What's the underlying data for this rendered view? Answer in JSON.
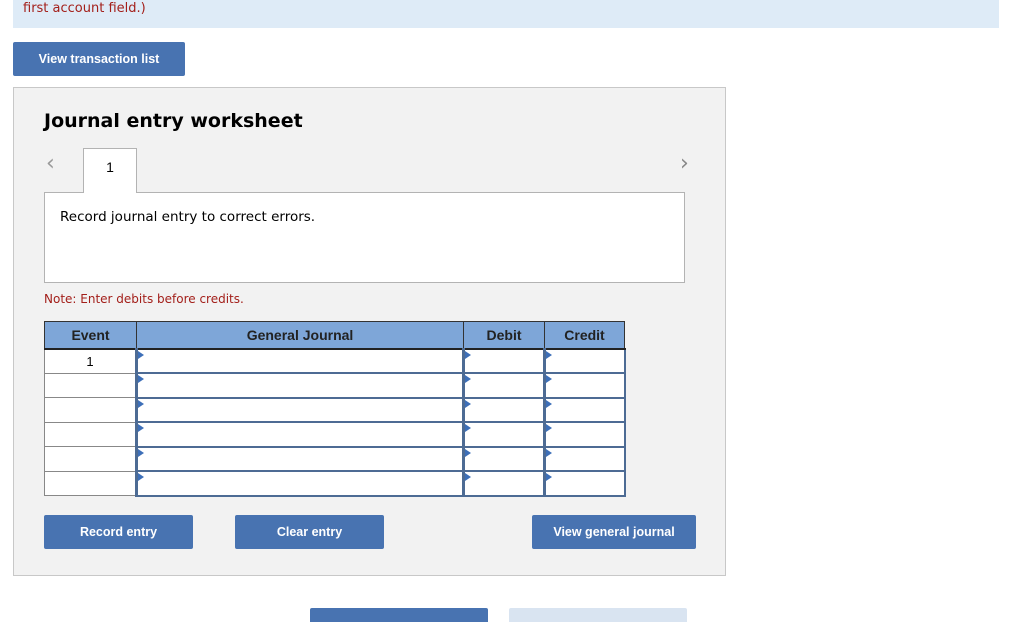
{
  "banner": {
    "text": "first account field.)"
  },
  "toolbar": {
    "view_transaction_list": "View transaction list"
  },
  "worksheet": {
    "title": "Journal entry worksheet",
    "tabs": [
      {
        "label": "1",
        "active": true
      }
    ],
    "description": "Record journal entry to correct errors.",
    "note": "Note: Enter debits before credits.",
    "table": {
      "headers": {
        "event": "Event",
        "account": "General Journal",
        "debit": "Debit",
        "credit": "Credit"
      },
      "rows": [
        {
          "event": "1",
          "account": "",
          "debit": "",
          "credit": ""
        },
        {
          "event": "",
          "account": "",
          "debit": "",
          "credit": ""
        },
        {
          "event": "",
          "account": "",
          "debit": "",
          "credit": ""
        },
        {
          "event": "",
          "account": "",
          "debit": "",
          "credit": ""
        },
        {
          "event": "",
          "account": "",
          "debit": "",
          "credit": ""
        },
        {
          "event": "",
          "account": "",
          "debit": "",
          "credit": ""
        }
      ]
    },
    "buttons": {
      "record": "Record entry",
      "clear": "Clear entry",
      "view_general_journal": "View general journal"
    },
    "icons": {
      "prev": "chevron-left-icon",
      "next": "chevron-right-icon"
    }
  },
  "colors": {
    "accent": "#4873b1",
    "header": "#7ea6d8",
    "note": "#a31f1a",
    "banner": "#deebf7"
  }
}
